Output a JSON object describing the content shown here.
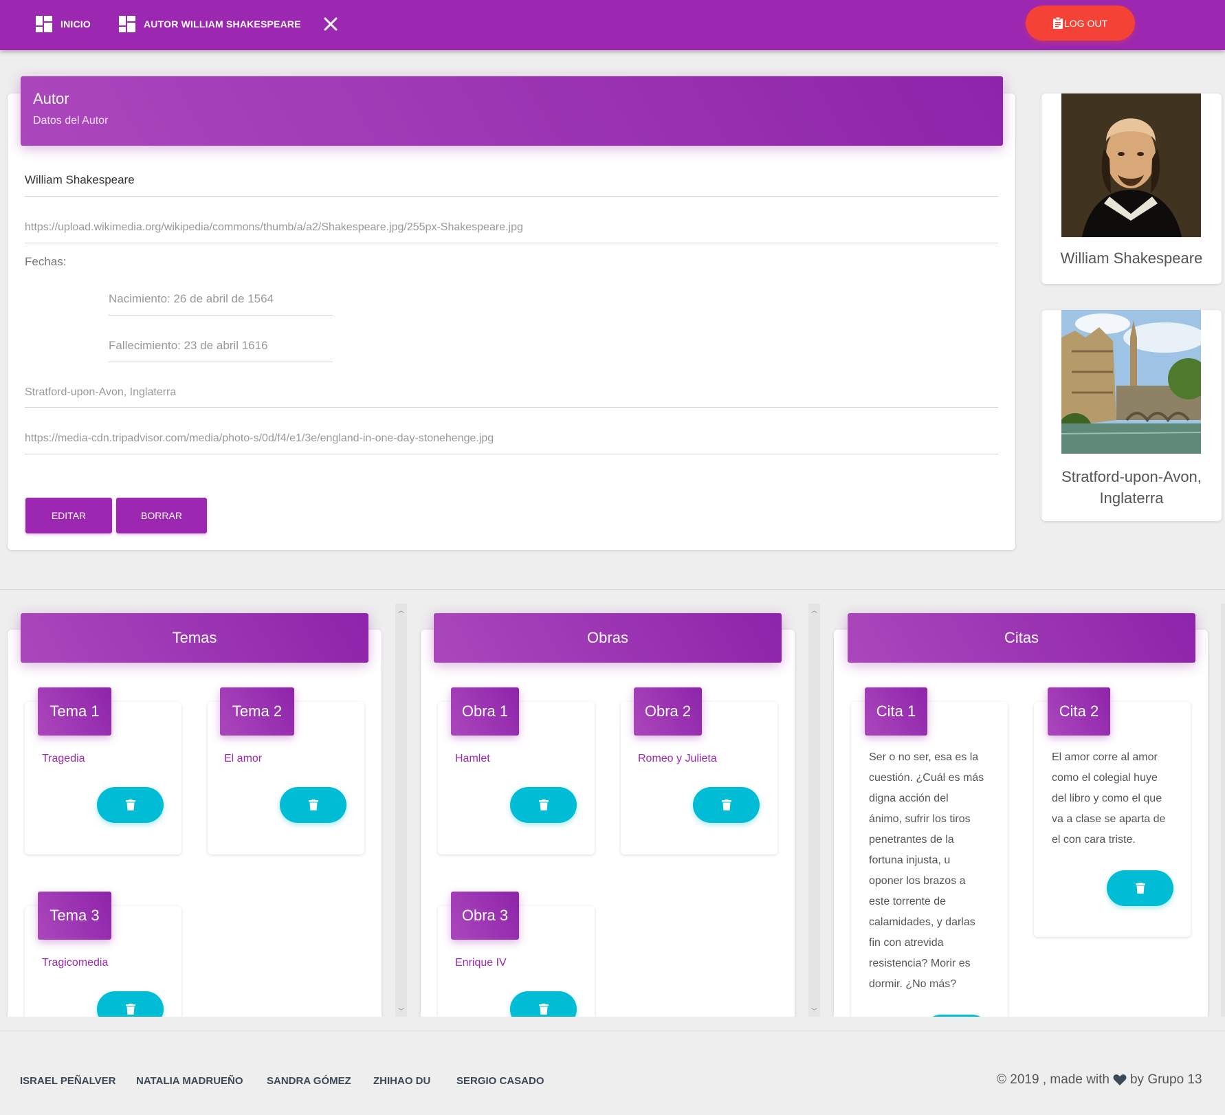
{
  "nav": {
    "links": [
      {
        "label": "INICIO",
        "icon": "dashboard-icon"
      },
      {
        "label": "AUTOR WILLIAM SHAKESPEARE",
        "icon": "dashboard-icon"
      }
    ],
    "logout_label": "LOG OUT",
    "color": "#9c27b0",
    "logout_color": "#f44336"
  },
  "author": {
    "header_title": "Autor",
    "header_subtitle": "Datos del Autor",
    "name_value": "William Shakespeare",
    "image_url_value": "https://upload.wikimedia.org/wikipedia/commons/thumb/a/a2/Shakespeare.jpg/255px-Shakespeare.jpg",
    "dates_label": "Fechas:",
    "birth_value": "Nacimiento:  26 de abril de 1564",
    "death_value": "Fallecimiento: 23 de abril 1616",
    "place_value": "Stratford-upon-Avon, Inglaterra",
    "place_image_value": "https://media-cdn.tripadvisor.com/media/photo-s/0d/f4/e1/3e/england-in-one-day-stonehenge.jpg",
    "edit_label": "EDITAR",
    "delete_label": "BORRAR"
  },
  "profile": {
    "name": "William Shakespeare",
    "place_line1": "Stratford-upon-Avon,",
    "place_line2": "Inglaterra"
  },
  "columns": {
    "temas": {
      "title": "Temas",
      "items": [
        {
          "tag": "Tema 1",
          "text": "Tragedia"
        },
        {
          "tag": "Tema 2",
          "text": "El amor"
        },
        {
          "tag": "Tema 3",
          "text": "Tragicomedia"
        }
      ]
    },
    "obras": {
      "title": "Obras",
      "items": [
        {
          "tag": "Obra 1",
          "text": "Hamlet"
        },
        {
          "tag": "Obra 2",
          "text": "Romeo y Julieta"
        },
        {
          "tag": "Obra 3",
          "text": "Enrique IV"
        }
      ]
    },
    "citas": {
      "title": "Citas",
      "items": [
        {
          "tag": "Cita 1",
          "lines": [
            "Ser o no ser, esa es la",
            "cuestión. ¿Cuál es más",
            "digna acción del",
            "ánimo, sufrir los tiros",
            "penetrantes de la",
            "fortuna injusta, u",
            "oponer los brazos a",
            "este torrente de",
            "calamidades, y darlas",
            "fin con atrevida",
            "resistencia? Morir es",
            "dormir. ¿No más?"
          ]
        },
        {
          "tag": "Cita 2",
          "lines": [
            "El amor corre al amor",
            "como el colegial huye",
            "del libro y como el que",
            "va a clase se aparta de",
            "el con cara triste."
          ]
        }
      ]
    }
  },
  "footer": {
    "links": [
      "ISRAEL PEÑALVER",
      "NATALIA MADRUEÑO",
      "SANDRA GÓMEZ",
      "ZHIHAO DU",
      "SERGIO CASADO"
    ],
    "copy_before": "© 2019 , made with",
    "copy_after": "by Grupo 13"
  },
  "trash_color": "#00bcd4"
}
